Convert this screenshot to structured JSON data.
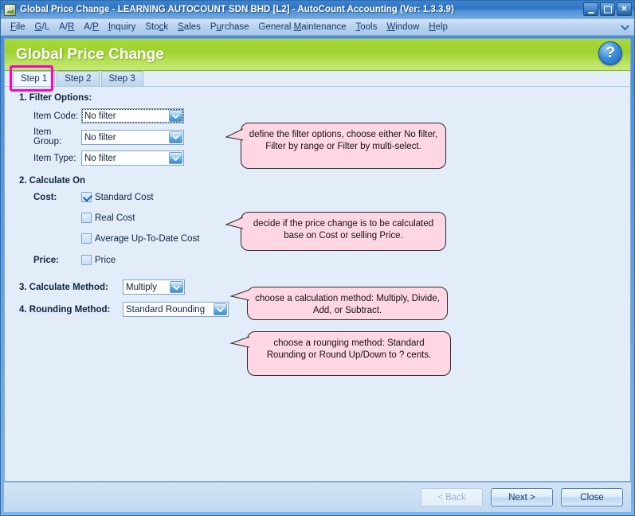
{
  "window": {
    "title": "Global Price Change - LEARNING AUTOCOUNT SDN BHD [L2] - AutoCount Accounting (Ver: 1.3.3.9)",
    "app_icon": "autocount-icon",
    "controls": {
      "minimize": "minimize-icon",
      "maximize": "maximize-icon",
      "close": "close-icon"
    }
  },
  "menubar": {
    "items": [
      {
        "label": "File",
        "accel": "F"
      },
      {
        "label": "G/L",
        "accel": "G"
      },
      {
        "label": "A/R",
        "accel": "R"
      },
      {
        "label": "A/P",
        "accel": "P"
      },
      {
        "label": "Inquiry",
        "accel": "I"
      },
      {
        "label": "Stock",
        "accel": "c"
      },
      {
        "label": "Sales",
        "accel": "S"
      },
      {
        "label": "Purchase",
        "accel": "u"
      },
      {
        "label": "General Maintenance",
        "accel": "M"
      },
      {
        "label": "Tools",
        "accel": "T"
      },
      {
        "label": "Window",
        "accel": "W"
      },
      {
        "label": "Help",
        "accel": "H"
      }
    ],
    "overflow_icon": "chevron-down-icon"
  },
  "banner": {
    "title": "Global Price Change",
    "help_icon": "help-question-icon",
    "accent_color": "#9ed22f"
  },
  "tabs": [
    {
      "label": "Step 1",
      "active": true
    },
    {
      "label": "Step 2",
      "active": false
    },
    {
      "label": "Step 3",
      "active": false
    }
  ],
  "highlight_color": "#ff00c8",
  "sections": {
    "filter_options": {
      "heading": "1. Filter Options:",
      "fields": [
        {
          "label": "Item Code:",
          "value": "No filter"
        },
        {
          "label": "Item Group:",
          "value": "No filter"
        },
        {
          "label": "Item Type:",
          "value": "No filter"
        }
      ]
    },
    "calculate_on": {
      "heading": "2. Calculate On",
      "cost_label": "Cost:",
      "price_label": "Price:",
      "cost_options": [
        {
          "label": "Standard Cost",
          "checked": true
        },
        {
          "label": "Real Cost",
          "checked": false
        },
        {
          "label": "Average Up-To-Date Cost",
          "checked": false
        }
      ],
      "price_options": [
        {
          "label": "Price",
          "checked": false
        }
      ]
    },
    "calculate_method": {
      "label": "3. Calculate Method:",
      "value": "Multiply"
    },
    "rounding_method": {
      "label": "4. Rounding Method:",
      "value": "Standard Rounding"
    }
  },
  "callouts": [
    {
      "text": "define the filter options, choose either No filter, Filter by range or Filter by multi-select."
    },
    {
      "text": "decide if the price change is to be calculated base on Cost or selling Price."
    },
    {
      "text": "choose a calculation method: Multiply, Divide, Add, or Subtract."
    },
    {
      "text": "choose a rounging method: Standard Rounding or Round Up/Down to ? cents."
    }
  ],
  "footer": {
    "back": "< Back",
    "next": "Next >",
    "close": "Close"
  }
}
